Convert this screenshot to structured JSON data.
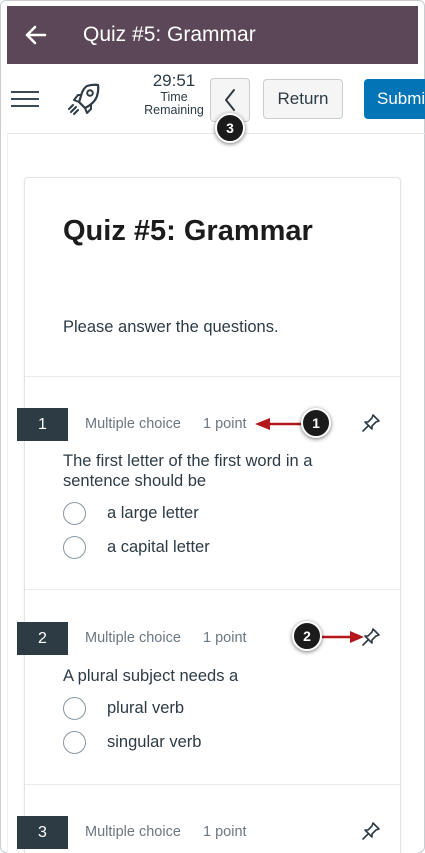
{
  "header": {
    "title": "Quiz #5: Grammar"
  },
  "toolbar": {
    "time": "29:51",
    "time_label_1": "Time",
    "time_label_2": "Remaining",
    "return_label": "Return",
    "submit_label": "Submit"
  },
  "quiz": {
    "title": "Quiz #5: Grammar",
    "instructions": "Please answer the questions."
  },
  "questions": [
    {
      "number": "1",
      "type": "Multiple choice",
      "points": "1 point",
      "text": "The first letter of the first word in a sentence should be",
      "options": [
        "a large letter",
        "a capital letter"
      ]
    },
    {
      "number": "2",
      "type": "Multiple choice",
      "points": "1 point",
      "text": "A plural subject needs a",
      "options": [
        "plural verb",
        "singular verb"
      ]
    },
    {
      "number": "3",
      "type": "Multiple choice",
      "points": "1 point"
    }
  ],
  "callouts": {
    "c1": "1",
    "c2": "2",
    "c3": "3"
  },
  "colors": {
    "header_bg": "#5b4757",
    "submit_bg": "#0374b5",
    "qnum_bg": "#2d3b45",
    "callout_arrow": "#b3171c"
  },
  "icons": [
    "back-arrow-icon",
    "hamburger-icon",
    "rocket-icon",
    "chevron-left-icon",
    "pin-icon"
  ]
}
